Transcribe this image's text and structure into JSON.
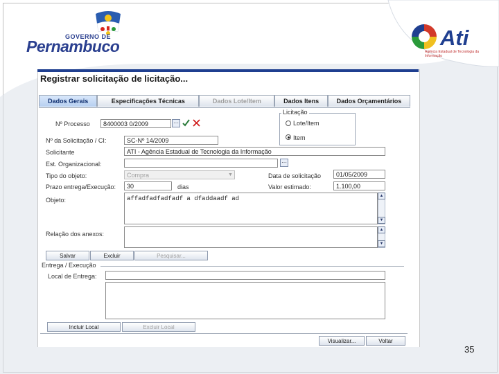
{
  "slide": {
    "number": "35"
  },
  "logos": {
    "pe_small": "GOVERNO DE",
    "pe_big": "Pernambuco",
    "ati_name": "Ati",
    "ati_sub": "Agência Estadual de Tecnologia da Informação"
  },
  "window": {
    "title": "Registrar solicitação de licitação..."
  },
  "tabs": [
    {
      "label": "Dados Gerais",
      "state": "active"
    },
    {
      "label": "Especificações Técnicas",
      "state": "normal"
    },
    {
      "label": "Dados Lote/Item",
      "state": "disabled"
    },
    {
      "label": "Dados Itens",
      "state": "normal"
    },
    {
      "label": "Dados Orçamentários",
      "state": "normal"
    }
  ],
  "form": {
    "processo_label": "Nº Processo",
    "processo_value": "8400003 0/2009",
    "solicitacao_label": "Nº da Solicitação / CI:",
    "solicitacao_value": "SC-Nº 14/2009",
    "solicitante_label": "Solicitante",
    "solicitante_value": "ATI - Agência Estadual de Tecnologia da Informação",
    "est_org_label": "Est. Organizacional:",
    "est_org_value": "",
    "tipo_objeto_label": "Tipo do objeto:",
    "tipo_objeto_value": "Compra",
    "data_solic_label": "Data de solicitação",
    "data_solic_value": "01/05/2009",
    "prazo_label": "Prazo entrega/Execução:",
    "prazo_value": "30",
    "prazo_unit": "dias",
    "valor_label": "Valor estimado:",
    "valor_value": "1.100,00",
    "objeto_label": "Objeto:",
    "objeto_value": "affadfadfadfadf a dfaddaadf ad",
    "anexos_label": "Relação dos anexos:",
    "anexos_value": "",
    "licitacao_legend": "Licitação",
    "radio_lote": "Lote/Item",
    "radio_item": "Item"
  },
  "buttons": {
    "salvar": "Salvar",
    "excluir": "Excluir",
    "pesquisar": "Pesquisar...",
    "incluir_local": "Incluir Local",
    "excluir_local": "Excluir Local",
    "visualizar": "Visualizar...",
    "voltar": "Voltar"
  },
  "entrega": {
    "section_label": "Entrega / Execução",
    "local_label": "Local de Entrega:",
    "local_value": ""
  },
  "icons": {
    "ellipsis": "ellipsis-icon",
    "check": "check-icon",
    "close": "close-icon"
  },
  "colors": {
    "tab_active": "#b7cff0",
    "brand_blue": "#2a3f8f",
    "ati_red": "#d23a2a",
    "ati_green": "#2a9a3a",
    "ati_yellow": "#f0c020"
  }
}
